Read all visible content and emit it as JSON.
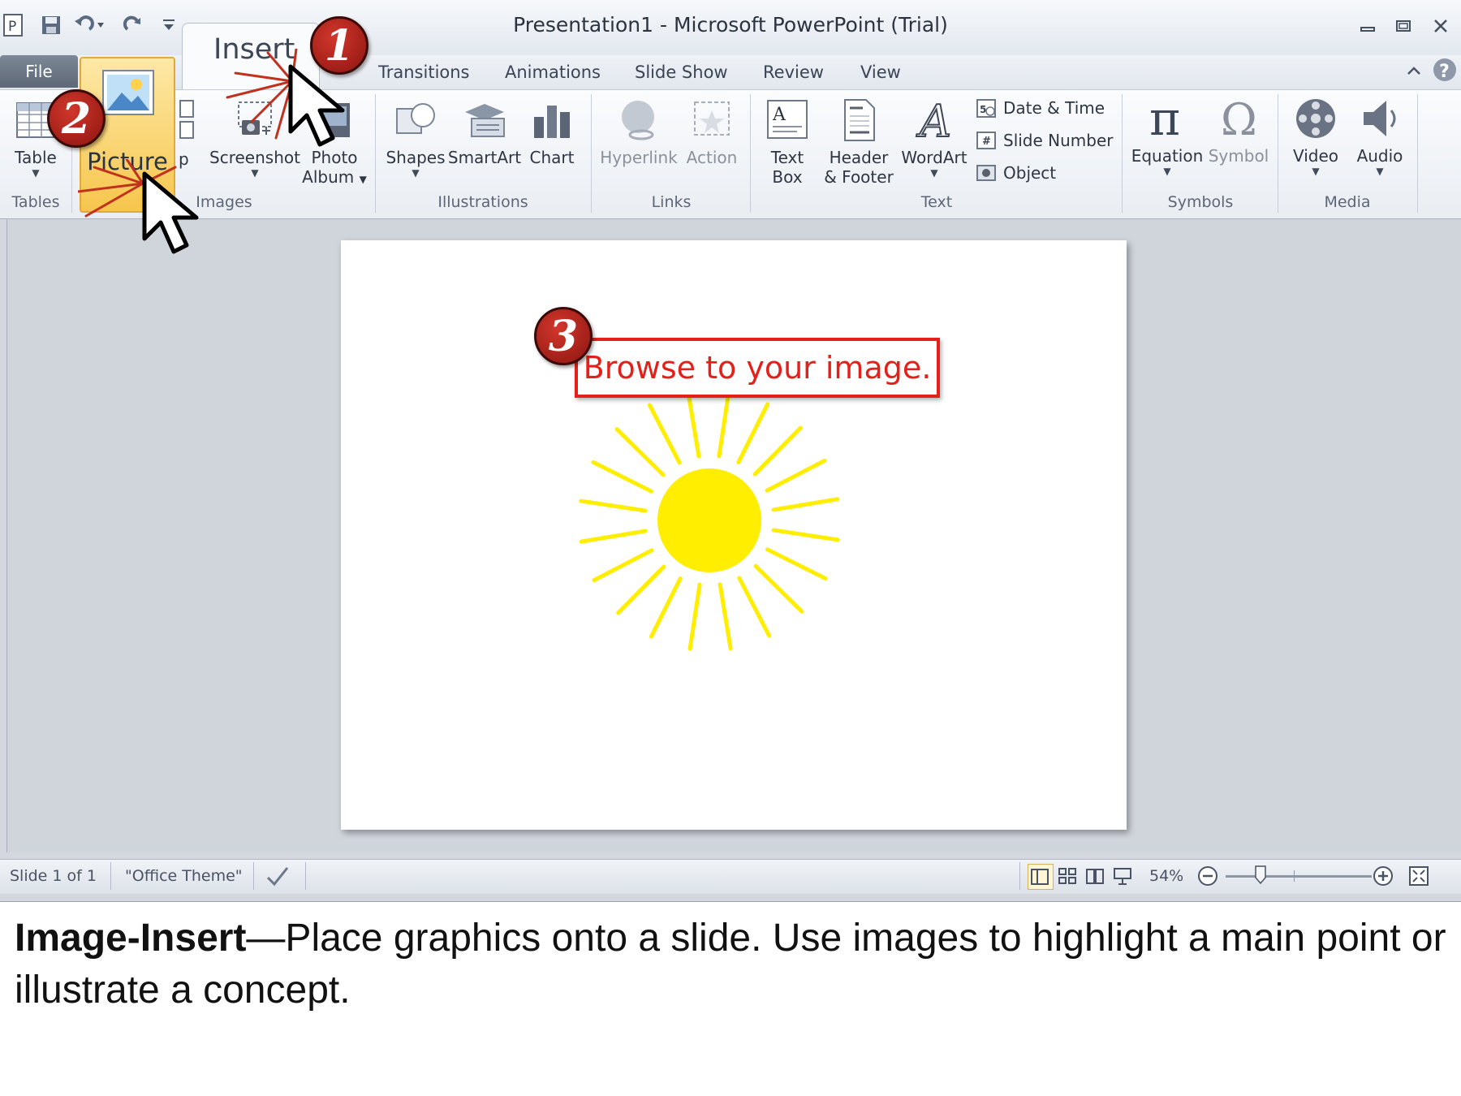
{
  "window": {
    "title": "Presentation1  -  Microsoft PowerPoint (Trial)",
    "file_tab": "File",
    "tabs": [
      "Insert",
      "Transitions",
      "Animations",
      "Slide Show",
      "Review",
      "View"
    ]
  },
  "ribbon": {
    "groups": {
      "tables": "Tables",
      "images": "Images",
      "illustrations": "Illustrations",
      "links": "Links",
      "text": "Text",
      "symbols": "Symbols",
      "media": "Media"
    },
    "buttons": {
      "table": "Table",
      "picture": "Picture",
      "clip_art_partial": "p",
      "screenshot": "Screenshot",
      "photo_album_line1": "Photo",
      "photo_album_line2": "Album",
      "shapes": "Shapes",
      "smartart": "SmartArt",
      "chart": "Chart",
      "hyperlink": "Hyperlink",
      "action": "Action",
      "text_box_line1": "Text",
      "text_box_line2": "Box",
      "header_footer_line1": "Header",
      "header_footer_line2": "& Footer",
      "wordart": "WordArt",
      "date_time": "Date & Time",
      "slide_number": "Slide Number",
      "object": "Object",
      "equation": "Equation",
      "symbol": "Symbol",
      "video": "Video",
      "audio": "Audio"
    }
  },
  "slide": {
    "callout": "Browse to your image."
  },
  "steps": [
    "1",
    "2",
    "3"
  ],
  "status": {
    "slide": "Slide 1 of 1",
    "theme": "\"Office Theme\"",
    "zoom": "54%"
  },
  "caption": {
    "bold": "Image-Insert",
    "rest": "—Place graphics onto a slide.  Use images to highlight a main point or illustrate a concept."
  },
  "colors": {
    "accent_red": "#e3201a",
    "sun": "#ffee00",
    "picture_highlight": "#f8d66a"
  }
}
